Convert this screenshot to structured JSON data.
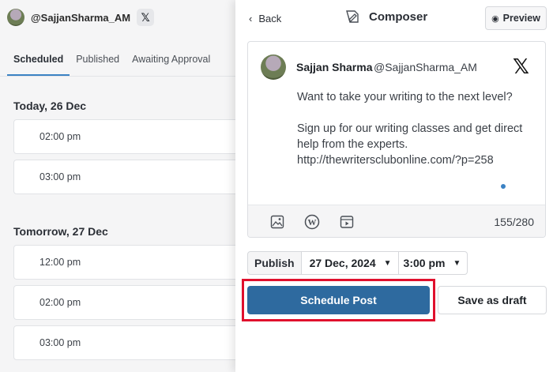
{
  "left": {
    "account": {
      "handle": "@SajjanSharma_AM",
      "network_badge": "𝕏"
    },
    "tabs": [
      {
        "label": "Scheduled",
        "active": true
      },
      {
        "label": "Published",
        "active": false
      },
      {
        "label": "Awaiting Approval",
        "active": false
      }
    ],
    "days": [
      {
        "title": "Today, 26 Dec",
        "slots": [
          "02:00 pm",
          "03:00 pm"
        ]
      },
      {
        "title": "Tomorrow, 27 Dec",
        "slots": [
          "12:00 pm",
          "02:00 pm",
          "03:00 pm"
        ]
      }
    ]
  },
  "composer": {
    "back_label": "Back",
    "title": "Composer",
    "preview_label": "Preview",
    "post": {
      "author_name": "Sajjan Sharma",
      "author_handle": "@SajjanSharma_AM",
      "network_logo": "𝕏",
      "paragraph1": "Want to take your writing to the next level?",
      "paragraph2": "Sign up for our writing classes and get direct help from the experts. http://thewritersclubonline.com/?p=258"
    },
    "toolbar_icons": [
      "image-icon",
      "wordpress-icon",
      "video-icon"
    ],
    "char_count": "155/280",
    "publish": {
      "label": "Publish",
      "date": "27 Dec, 2024",
      "time": "3:00 pm"
    },
    "schedule_label": "Schedule Post",
    "draft_label": "Save as draft",
    "accent_color": "#2e6a9f",
    "highlight_color": "#e0102d"
  }
}
